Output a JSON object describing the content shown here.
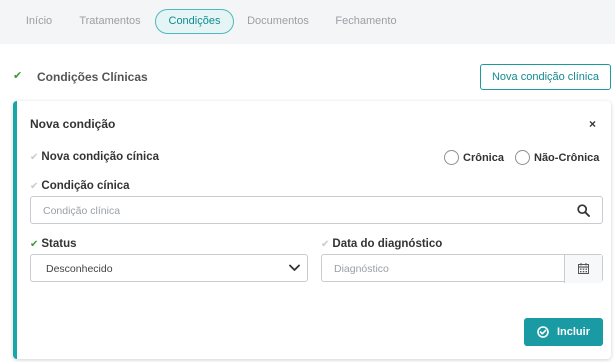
{
  "tabs": [
    {
      "label": "Início"
    },
    {
      "label": "Tratamentos"
    },
    {
      "label": "Condições"
    },
    {
      "label": "Documentos"
    },
    {
      "label": "Fechamento"
    }
  ],
  "active_tab": "Condições",
  "section": {
    "title": "Condições Clínicas",
    "new_button": "Nova condição clínica"
  },
  "card": {
    "title": "Nova condição",
    "close": "×",
    "subtitle": "Nova condição cínica",
    "radios": [
      "Crônica",
      "Não-Crônica"
    ],
    "condition_label": "Condição cínica",
    "condition_placeholder": "Condição clínica",
    "status_label": "Status",
    "status_value": "Desconhecido",
    "date_label": "Data do diagnóstico",
    "date_placeholder": "Diagnóstico",
    "include_button": "Incluir"
  },
  "icons": {
    "check": "check-icon",
    "search": "search-icon",
    "calendar": "calendar-icon",
    "chevron": "chevron-down-icon",
    "include": "check-circle-icon"
  },
  "colors": {
    "accent": "#1a9aa3",
    "tab_active_bg": "#e5f5f6",
    "check_green": "#3a9a3a"
  }
}
